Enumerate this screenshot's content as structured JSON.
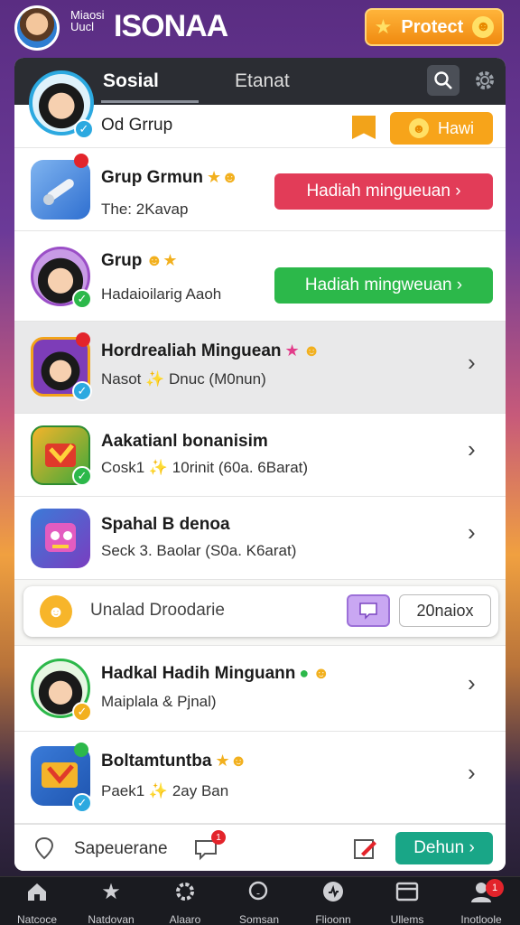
{
  "app": {
    "title_small": "Miaosi Uucl",
    "title": "ISONAA",
    "protect_label": "Protect"
  },
  "panel": {
    "tabs": [
      {
        "label": "Sosial"
      },
      {
        "label": "Etanat"
      }
    ],
    "top_row": {
      "title": "Od Grrup",
      "button_label": "Hawi"
    },
    "rows": [
      {
        "title": "Grup Grmun",
        "subtitle": "The: 2Kavap",
        "button_label": "Hadiah mingueuan ›"
      },
      {
        "title": "Grup",
        "subtitle": "Hadaioilarig Aaoh",
        "button_label": "Hadiah mingweuan ›"
      },
      {
        "title": "Hordrealiah Minguean",
        "subtitle": "Nasot ✨ Dnuc (M0nun)"
      },
      {
        "title": "Aakatianl bonanisim",
        "subtitle": "Cosk1 ✨ 10rinit (60a. 6Barat)"
      },
      {
        "title": "Spahal B denoa",
        "subtitle": "Seck 3. Baolar (S0a. K6arat)"
      },
      {
        "title": "Hadkal Hadih Minguann",
        "subtitle": "Maiplala & Pjnal)"
      },
      {
        "title": "Boltamtuntba",
        "subtitle": "Paek1 ✨ 2ay Ban"
      }
    ],
    "bonus": {
      "label": "Unalad Droodarie",
      "count": "20naiox"
    },
    "footer": {
      "label": "Sapeuerane",
      "button_label": "Dehun ›",
      "bubble_badge": "1"
    }
  },
  "bottom_nav": [
    {
      "label": "Natcoce"
    },
    {
      "label": "Natdovan"
    },
    {
      "label": "Alaaro"
    },
    {
      "label": "Somsan"
    },
    {
      "label": "Flioonn"
    },
    {
      "label": "Ullems"
    },
    {
      "label": "Inotloole",
      "badge": "1"
    }
  ],
  "colors": {
    "accent_orange": "#f7a41a",
    "red": "#e23c58",
    "green": "#2cb84a",
    "teal": "#19a687"
  }
}
